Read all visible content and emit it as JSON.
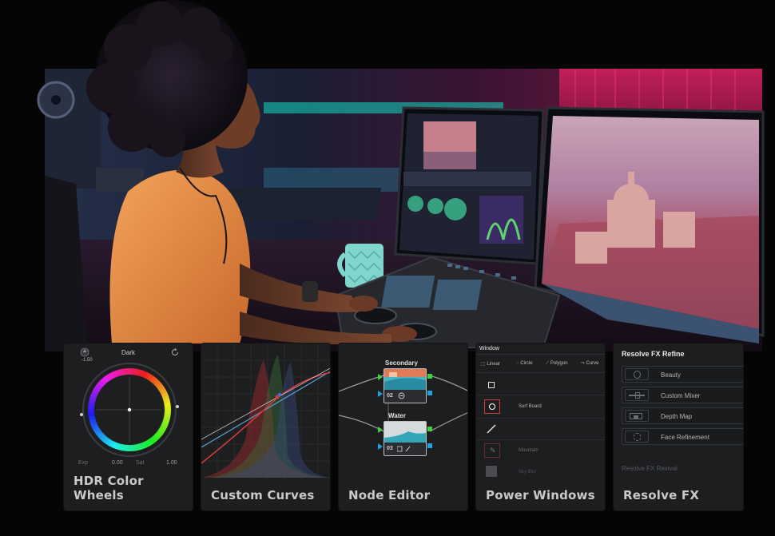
{
  "colors": {
    "page_background": "#050505",
    "card_background": "#1d1e20",
    "card_title": "#c9c9c9",
    "node_link_green": "#3fd13f",
    "node_link_blue": "#1fa3e0",
    "curve_red": "#d43a3a",
    "selection_red": "#d23b3b"
  },
  "cards": {
    "wheels": {
      "title": "HDR Color Wheels",
      "wheel_label": "Dark",
      "wheel_value": "-1.50",
      "exp_label": "Exp",
      "exp_value": "0.00",
      "sat_label": "Sat",
      "sat_value": "1.00",
      "icons": [
        "aperture-icon",
        "reset-icon"
      ]
    },
    "curves": {
      "title": "Custom Curves"
    },
    "nodes": {
      "title": "Node Editor",
      "node1_name": "Secondary",
      "node1_number": "02",
      "node2_name": "Water",
      "node2_number": "03"
    },
    "windows": {
      "title": "Power Windows",
      "header": "Window",
      "tools": [
        "Linear",
        "Circle",
        "Polygon",
        "Curve"
      ],
      "rows": [
        "",
        "Surf Board",
        "",
        "Mountain",
        "Sky Blur"
      ]
    },
    "fx": {
      "title": "Resolve FX",
      "header": "Resolve FX Refine",
      "items": [
        "Beauty",
        "Custom Mixer",
        "Depth Map",
        "Face Refinement"
      ],
      "section2": "Resolve FX Revival"
    }
  }
}
